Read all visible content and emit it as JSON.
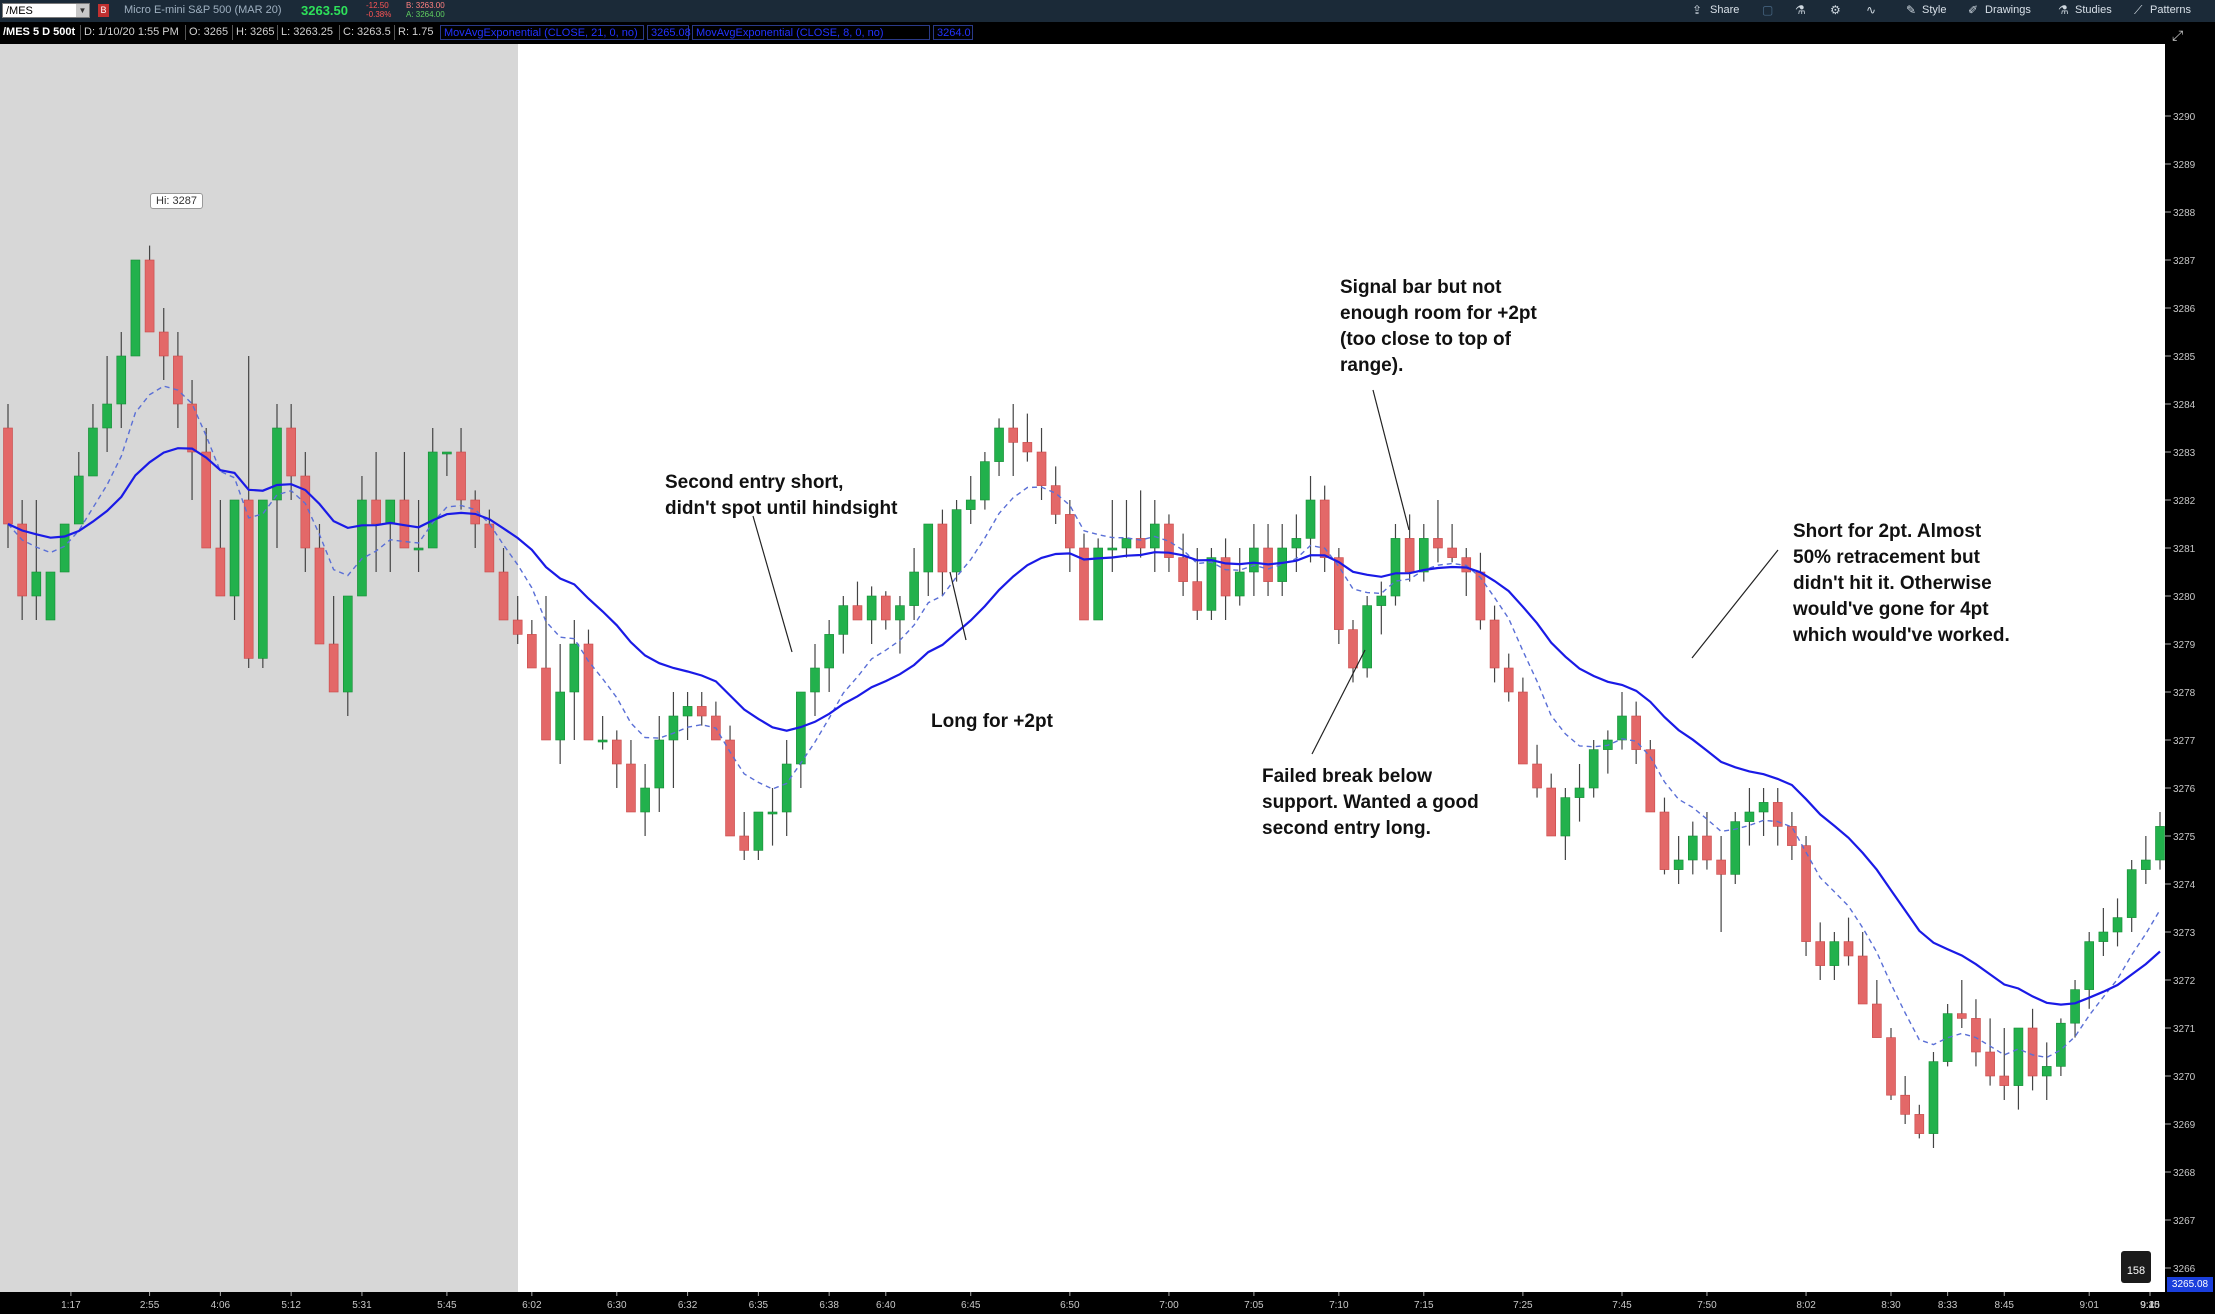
{
  "topbar": {
    "symbol": "/MES",
    "instrument": "Micro E-mini S&P 500 (MAR 20)",
    "last_price": "3263.50",
    "net_change": "-12.50",
    "pct_change": "-0.38%",
    "bid": "B: 3263.00",
    "ask": "A: 3264.00",
    "share_label": "Share",
    "style_label": "Style",
    "drawings_label": "Drawings",
    "studies_label": "Studies",
    "patterns_label": "Patterns"
  },
  "infobar": {
    "chart_spec": "/MES 5 D 500t",
    "date": "D: 1/10/20 1:55 PM",
    "open": "O: 3265",
    "high": "H: 3265",
    "low": "L: 3263.25",
    "close": "C: 3263.5",
    "range": "R: 1.75",
    "study1": "MovAvgExponential (CLOSE, 21, 0, no)",
    "study1_value": "3265.08",
    "study2": "MovAvgExponential (CLOSE, 8, 0, no)",
    "study2_value": "3264.0"
  },
  "colors": {
    "up_candle": "#22b14c",
    "down_candle": "#e36868",
    "ema_slow": "#1a1ae6",
    "ema_fast": "#5a6fd6",
    "shade": "#d7d7d7",
    "axis_bg": "#000000"
  },
  "chart_data": {
    "type": "candlestick",
    "y_axis": {
      "min": 3265.5,
      "max": 3291.5,
      "ticks": [
        3266,
        3267,
        3268,
        3269,
        3270,
        3271,
        3272,
        3273,
        3274,
        3275,
        3276,
        3277,
        3278,
        3279,
        3280,
        3281,
        3282,
        3283,
        3284,
        3285,
        3286,
        3287,
        3288,
        3289,
        3290
      ]
    },
    "x_ticks": [
      "1:17",
      "2:55",
      "4:06",
      "5:12",
      "5:31",
      "5:45",
      "6:02",
      "6:30",
      "6:32",
      "6:35",
      "6:38",
      "6:40",
      "6:45",
      "6:50",
      "7:00",
      "7:05",
      "7:10",
      "7:15",
      "7:25",
      "7:45",
      "7:50",
      "8:02",
      "8:30",
      "8:33",
      "8:45",
      "9:01",
      "9:10",
      "9:15",
      "9:25",
      "9:45"
    ],
    "high_label": "Hi: 3287",
    "bars_count_label": "158",
    "last_price_label": "3265.08",
    "candles": [
      [
        3283.5,
        3284,
        3281,
        3281.5
      ],
      [
        3281.5,
        3282,
        3279.5,
        3280
      ],
      [
        3280,
        3282,
        3279.5,
        3280.5
      ],
      [
        3279.5,
        3280.5,
        3279.5,
        3280.5
      ],
      [
        3280.5,
        3281.5,
        3280.5,
        3281.5
      ],
      [
        3281.5,
        3283,
        3281.5,
        3282.5
      ],
      [
        3282.5,
        3284,
        3282.5,
        3283.5
      ],
      [
        3283.5,
        3285,
        3283,
        3284
      ],
      [
        3284,
        3285.5,
        3283.5,
        3285
      ],
      [
        3285,
        3287,
        3285,
        3287
      ],
      [
        3287,
        3287.3,
        3285.5,
        3285.5
      ],
      [
        3285.5,
        3286,
        3284.5,
        3285
      ],
      [
        3285,
        3285.5,
        3283.5,
        3284
      ],
      [
        3284,
        3284.5,
        3282,
        3283
      ],
      [
        3283,
        3283.5,
        3281,
        3281
      ],
      [
        3281,
        3282,
        3280,
        3280
      ],
      [
        3280,
        3282,
        3279.5,
        3282
      ],
      [
        3282,
        3285,
        3278.5,
        3278.7
      ],
      [
        3278.7,
        3282,
        3278.5,
        3282
      ],
      [
        3282,
        3284,
        3281,
        3283.5
      ],
      [
        3283.5,
        3284,
        3282,
        3282.5
      ],
      [
        3282.5,
        3283,
        3280.5,
        3281
      ],
      [
        3281,
        3281.5,
        3279,
        3279
      ],
      [
        3279,
        3280,
        3278,
        3278
      ],
      [
        3278,
        3280,
        3277.5,
        3280
      ],
      [
        3280,
        3282.5,
        3280,
        3282
      ],
      [
        3282,
        3283,
        3280.5,
        3281.5
      ],
      [
        3281.5,
        3282,
        3280.5,
        3282
      ],
      [
        3282,
        3283,
        3281,
        3281
      ],
      [
        3281,
        3282,
        3280.5,
        3281
      ],
      [
        3281,
        3283.5,
        3281,
        3283
      ],
      [
        3283,
        3283,
        3282.5,
        3283
      ],
      [
        3283,
        3283.5,
        3281.8,
        3282
      ],
      [
        3282,
        3282.2,
        3281,
        3281.5
      ],
      [
        3281.5,
        3281.8,
        3280.5,
        3280.5
      ],
      [
        3280.5,
        3281,
        3279.5,
        3279.5
      ],
      [
        3279.5,
        3280,
        3279,
        3279.2
      ],
      [
        3279.2,
        3279.5,
        3278.5,
        3278.5
      ],
      [
        3278.5,
        3280,
        3277,
        3277
      ],
      [
        3277,
        3279,
        3276.5,
        3278
      ],
      [
        3278,
        3279.5,
        3277,
        3279
      ],
      [
        3279,
        3279.3,
        3277,
        3277
      ],
      [
        3277,
        3277.5,
        3276.8,
        3277
      ],
      [
        3277,
        3277.2,
        3276,
        3276.5
      ],
      [
        3276.5,
        3277,
        3275.5,
        3275.5
      ],
      [
        3275.5,
        3276.5,
        3275,
        3276
      ],
      [
        3276,
        3277.5,
        3275.5,
        3277
      ],
      [
        3277,
        3278,
        3276,
        3277.5
      ],
      [
        3277.5,
        3278,
        3277,
        3277.7
      ],
      [
        3277.7,
        3278,
        3277.3,
        3277.5
      ],
      [
        3277.5,
        3277.8,
        3277,
        3277
      ],
      [
        3277,
        3277.3,
        3275,
        3275
      ],
      [
        3275,
        3275.5,
        3274.5,
        3274.7
      ],
      [
        3274.7,
        3275.5,
        3274.5,
        3275.5
      ],
      [
        3275.5,
        3276,
        3274.8,
        3275.5
      ],
      [
        3275.5,
        3277,
        3275,
        3276.5
      ],
      [
        3276.5,
        3278,
        3276,
        3278
      ],
      [
        3278,
        3279,
        3277.5,
        3278.5
      ],
      [
        3278.5,
        3279.5,
        3278,
        3279.2
      ],
      [
        3279.2,
        3280,
        3278.8,
        3279.8
      ],
      [
        3279.8,
        3280.3,
        3279.5,
        3279.5
      ],
      [
        3279.5,
        3280.2,
        3279,
        3280
      ],
      [
        3280,
        3280.1,
        3279.3,
        3279.5
      ],
      [
        3279.5,
        3280,
        3278.8,
        3279.8
      ],
      [
        3279.8,
        3281,
        3279.5,
        3280.5
      ],
      [
        3280.5,
        3281.5,
        3280,
        3281.5
      ],
      [
        3281.5,
        3281.8,
        3280,
        3280.5
      ],
      [
        3280.5,
        3282,
        3280.3,
        3281.8
      ],
      [
        3281.8,
        3282.5,
        3281.5,
        3282
      ],
      [
        3282,
        3283,
        3281.8,
        3282.8
      ],
      [
        3282.8,
        3283.7,
        3282.5,
        3283.5
      ],
      [
        3283.5,
        3284,
        3282.5,
        3283.2
      ],
      [
        3283.2,
        3283.8,
        3282.8,
        3283
      ],
      [
        3283,
        3283.5,
        3282,
        3282.3
      ],
      [
        3282.3,
        3282.7,
        3281.5,
        3281.7
      ],
      [
        3281.7,
        3282,
        3280.5,
        3281
      ],
      [
        3281,
        3281.3,
        3279.5,
        3279.5
      ],
      [
        3279.5,
        3281.2,
        3279.5,
        3281
      ],
      [
        3281,
        3282,
        3280.5,
        3281
      ],
      [
        3281,
        3282,
        3280.8,
        3281.2
      ],
      [
        3281.2,
        3282.2,
        3280.8,
        3281
      ],
      [
        3281,
        3282,
        3280.5,
        3281.5
      ],
      [
        3281.5,
        3281.7,
        3280.5,
        3280.8
      ],
      [
        3280.8,
        3281.3,
        3280,
        3280.3
      ],
      [
        3280.3,
        3281,
        3279.5,
        3279.7
      ],
      [
        3279.7,
        3281,
        3279.5,
        3280.8
      ],
      [
        3280.8,
        3281.2,
        3279.5,
        3280
      ],
      [
        3280,
        3281,
        3279.8,
        3280.5
      ],
      [
        3280.5,
        3281.5,
        3280,
        3281
      ],
      [
        3281,
        3281.5,
        3280,
        3280.3
      ],
      [
        3280.3,
        3281.5,
        3280,
        3281
      ],
      [
        3281,
        3281.7,
        3280.5,
        3281.2
      ],
      [
        3281.2,
        3282.5,
        3280.7,
        3282
      ],
      [
        3282,
        3282.3,
        3280.5,
        3280.8
      ],
      [
        3280.8,
        3281,
        3279,
        3279.3
      ],
      [
        3279.3,
        3279.5,
        3278.2,
        3278.5
      ],
      [
        3278.5,
        3280,
        3278.3,
        3279.8
      ],
      [
        3279.8,
        3280.3,
        3279.2,
        3280
      ],
      [
        3280,
        3281.5,
        3279.8,
        3281.2
      ],
      [
        3281.2,
        3281.7,
        3280.3,
        3280.5
      ],
      [
        3280.5,
        3281.5,
        3280.3,
        3281.2
      ],
      [
        3281.2,
        3282,
        3280.7,
        3281
      ],
      [
        3281,
        3281.5,
        3280.7,
        3280.8
      ],
      [
        3280.8,
        3281,
        3280,
        3280.5
      ],
      [
        3280.5,
        3280.9,
        3279.3,
        3279.5
      ],
      [
        3279.5,
        3279.8,
        3278.2,
        3278.5
      ],
      [
        3278.5,
        3278.8,
        3277.8,
        3278
      ],
      [
        3278,
        3278.3,
        3276.5,
        3276.5
      ],
      [
        3276.5,
        3276.9,
        3275.8,
        3276
      ],
      [
        3276,
        3276.3,
        3275,
        3275
      ],
      [
        3275,
        3276,
        3274.5,
        3275.8
      ],
      [
        3275.8,
        3276.5,
        3275.3,
        3276
      ],
      [
        3276,
        3277,
        3275.8,
        3276.8
      ],
      [
        3276.8,
        3277.2,
        3276.3,
        3277
      ],
      [
        3277,
        3278,
        3276.8,
        3277.5
      ],
      [
        3277.5,
        3277.8,
        3276.5,
        3276.8
      ],
      [
        3276.8,
        3277,
        3275.5,
        3275.5
      ],
      [
        3275.5,
        3275.8,
        3274.2,
        3274.3
      ],
      [
        3274.3,
        3275,
        3274,
        3274.5
      ],
      [
        3274.5,
        3275.3,
        3274.2,
        3275
      ],
      [
        3275,
        3275.5,
        3274.3,
        3274.5
      ],
      [
        3274.5,
        3275,
        3273,
        3274.2
      ],
      [
        3274.2,
        3275.5,
        3274,
        3275.3
      ],
      [
        3275.3,
        3276,
        3274.8,
        3275.5
      ],
      [
        3275.5,
        3276,
        3275,
        3275.7
      ],
      [
        3275.7,
        3276,
        3274.8,
        3275.2
      ],
      [
        3275.2,
        3275.5,
        3274.5,
        3274.8
      ],
      [
        3274.8,
        3275,
        3272.5,
        3272.8
      ],
      [
        3272.8,
        3273.2,
        3272,
        3272.3
      ],
      [
        3272.3,
        3273,
        3272,
        3272.8
      ],
      [
        3272.8,
        3273.3,
        3272.3,
        3272.5
      ],
      [
        3272.5,
        3273,
        3271.5,
        3271.5
      ],
      [
        3271.5,
        3272,
        3270.8,
        3270.8
      ],
      [
        3270.8,
        3271,
        3269.5,
        3269.6
      ],
      [
        3269.6,
        3270,
        3269,
        3269.2
      ],
      [
        3269.2,
        3269.4,
        3268.7,
        3268.8
      ],
      [
        3268.8,
        3270.5,
        3268.5,
        3270.3
      ],
      [
        3270.3,
        3271.5,
        3270.2,
        3271.3
      ],
      [
        3271.3,
        3272,
        3271,
        3271.2
      ],
      [
        3271.2,
        3271.6,
        3270.2,
        3270.5
      ],
      [
        3270.5,
        3271.2,
        3269.8,
        3270
      ],
      [
        3270,
        3271,
        3269.5,
        3269.8
      ],
      [
        3269.8,
        3271,
        3269.3,
        3271
      ],
      [
        3271,
        3271.4,
        3269.7,
        3270
      ],
      [
        3270,
        3270.7,
        3269.5,
        3270.2
      ],
      [
        3270.2,
        3271.2,
        3270,
        3271.1
      ],
      [
        3271.1,
        3272,
        3270.8,
        3271.8
      ],
      [
        3271.8,
        3273,
        3271.4,
        3272.8
      ],
      [
        3272.8,
        3273.5,
        3272.5,
        3273
      ],
      [
        3273,
        3273.7,
        3272.7,
        3273.3
      ],
      [
        3273.3,
        3274.5,
        3273,
        3274.3
      ],
      [
        3274.3,
        3275,
        3274,
        3274.5
      ],
      [
        3274.5,
        3275.5,
        3274.3,
        3275.2
      ]
    ]
  },
  "annotations": {
    "a1": "Second entry short,\ndidn't spot until hindsight",
    "a2": "Long for +2pt",
    "a3": "Signal bar but not\nenough room for +2pt\n(too close to top of\nrange).",
    "a4": "Failed break below\nsupport. Wanted a good\nsecond entry long.",
    "a5": "Short for 2pt. Almost\n50% retracement but\ndidn't hit it. Otherwise\nwould've gone for 4pt\nwhich would've worked."
  }
}
